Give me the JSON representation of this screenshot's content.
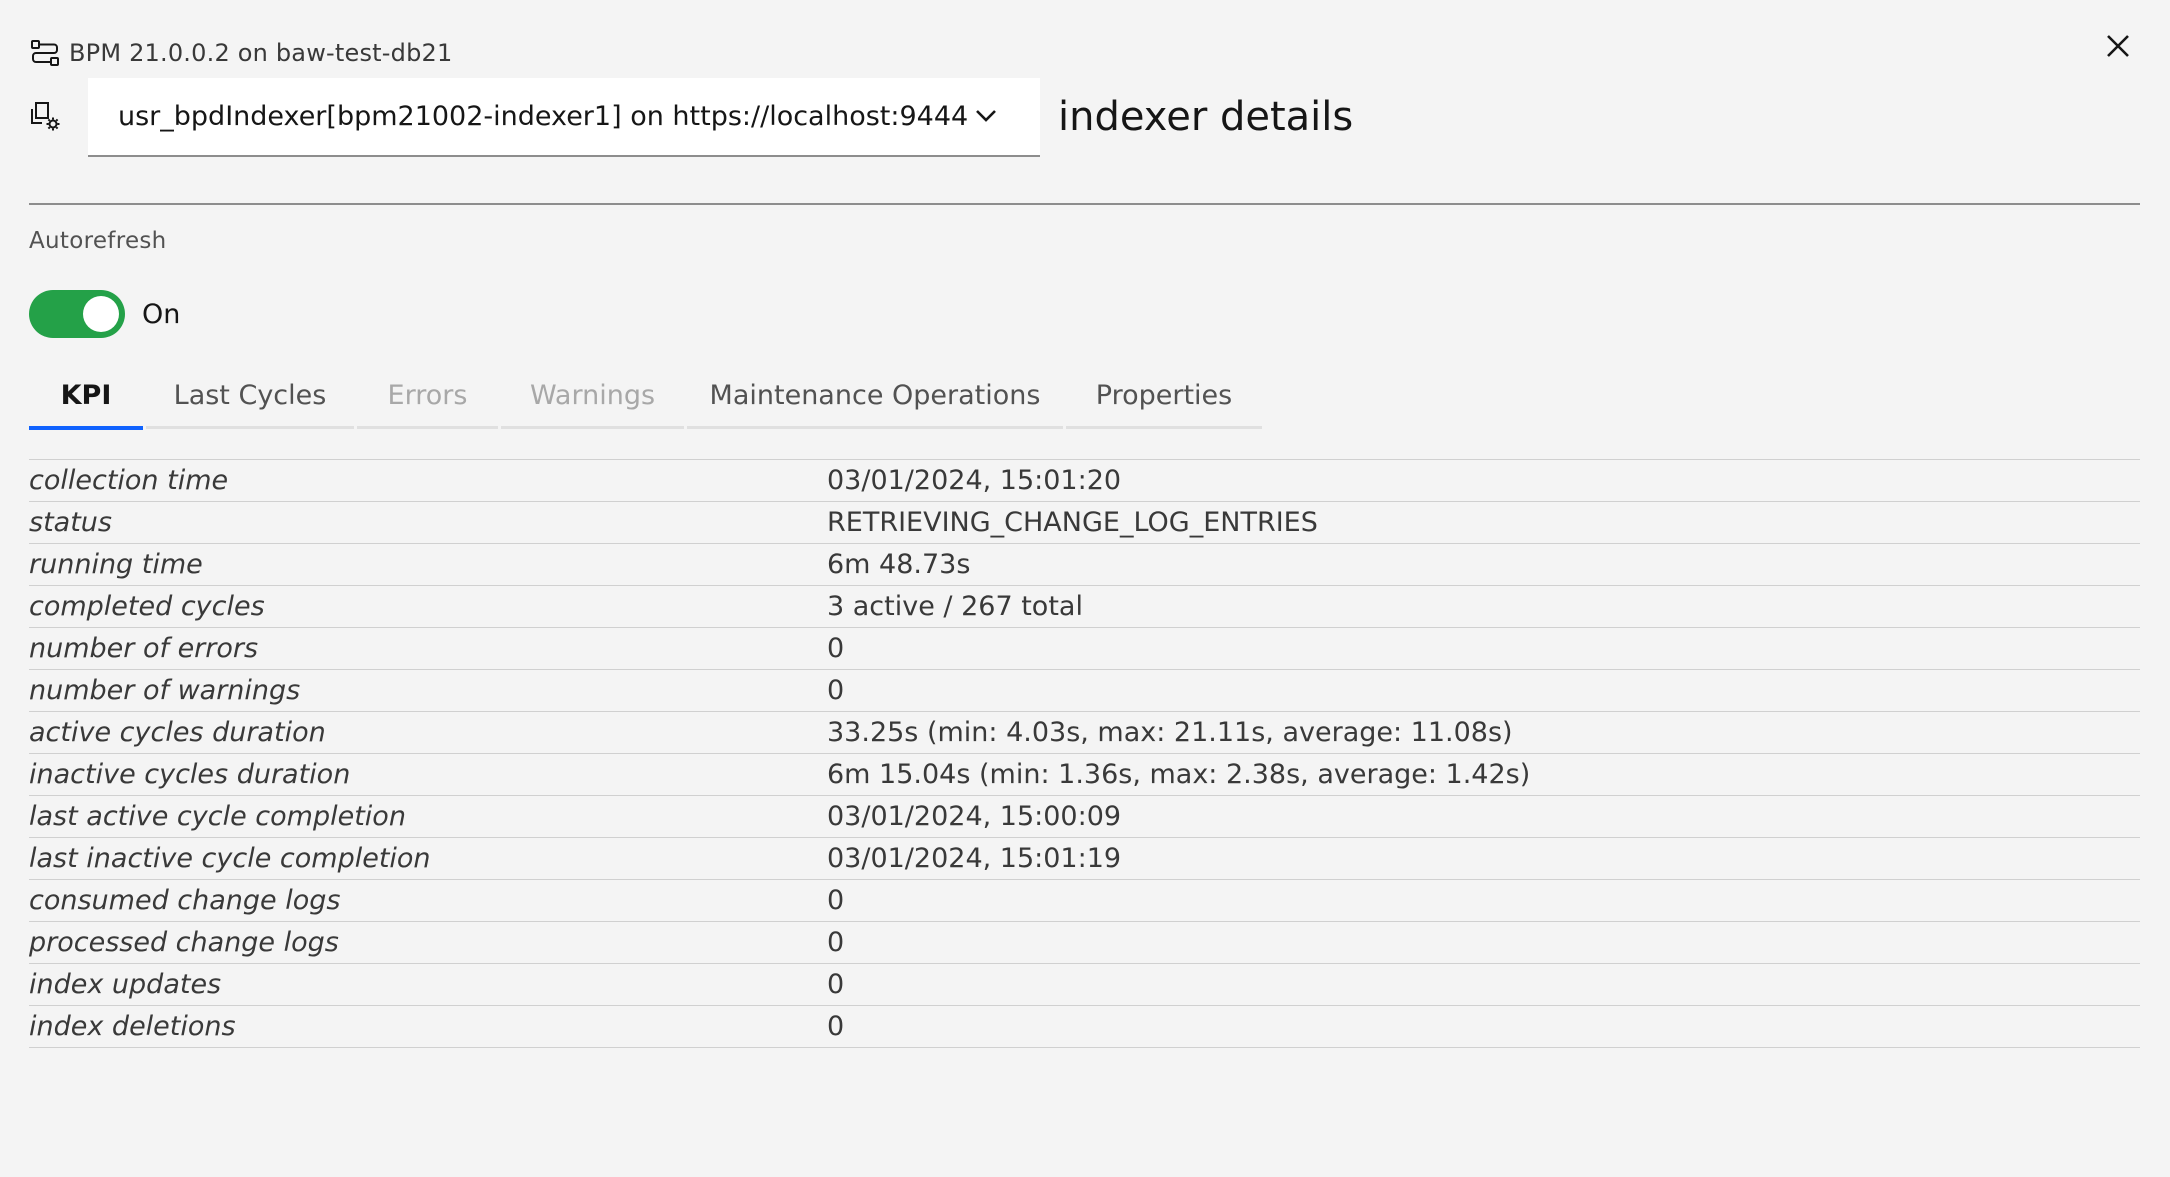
{
  "header": {
    "server_title": "BPM 21.0.0.2 on baw-test-db21",
    "server_icon": "workflow-icon",
    "close_icon": "close-icon"
  },
  "selector": {
    "icon": "settings-services-icon",
    "value": "usr_bpdIndexer[bpm21002-indexer1] on https://localhost:9444",
    "chevron_icon": "chevron-down-icon"
  },
  "page_title": "indexer details",
  "autorefresh": {
    "label": "Autorefresh",
    "state_text": "On",
    "enabled": true,
    "color": "#24a148"
  },
  "tabs": [
    {
      "label": "KPI",
      "active": true,
      "disabled": false
    },
    {
      "label": "Last Cycles",
      "active": false,
      "disabled": false
    },
    {
      "label": "Errors",
      "active": false,
      "disabled": true
    },
    {
      "label": "Warnings",
      "active": false,
      "disabled": true
    },
    {
      "label": "Maintenance Operations",
      "active": false,
      "disabled": false
    },
    {
      "label": "Properties",
      "active": false,
      "disabled": false
    }
  ],
  "accent_color": "#0f62fe",
  "kpi": [
    {
      "key": "collection time",
      "value": "03/01/2024, 15:01:20"
    },
    {
      "key": "status",
      "value": "RETRIEVING_CHANGE_LOG_ENTRIES"
    },
    {
      "key": "running time",
      "value": "6m 48.73s"
    },
    {
      "key": "completed cycles",
      "value": "3 active / 267 total"
    },
    {
      "key": "number of errors",
      "value": "0"
    },
    {
      "key": "number of warnings",
      "value": "0"
    },
    {
      "key": "active cycles duration",
      "value": "33.25s (min: 4.03s, max: 21.11s, average: 11.08s)"
    },
    {
      "key": "inactive cycles duration",
      "value": "6m 15.04s (min: 1.36s, max: 2.38s, average: 1.42s)"
    },
    {
      "key": "last active cycle completion",
      "value": "03/01/2024, 15:00:09"
    },
    {
      "key": "last inactive cycle completion",
      "value": "03/01/2024, 15:01:19"
    },
    {
      "key": "consumed change logs",
      "value": "0"
    },
    {
      "key": "processed change logs",
      "value": "0"
    },
    {
      "key": "index updates",
      "value": "0"
    },
    {
      "key": "index deletions",
      "value": "0"
    }
  ]
}
